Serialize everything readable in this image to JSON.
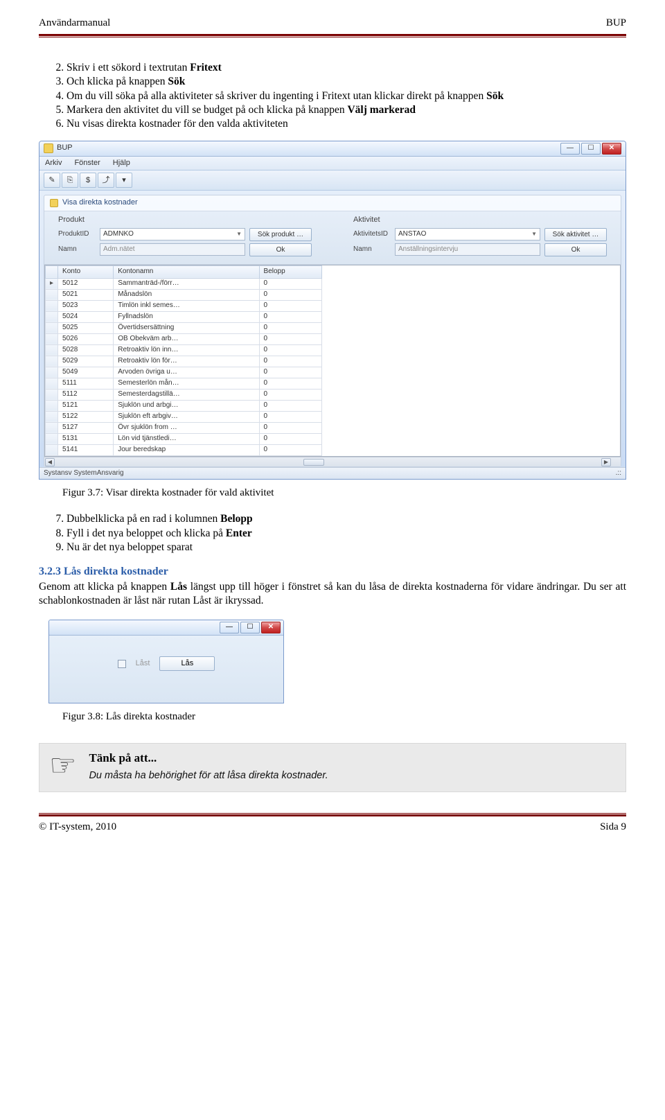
{
  "header": {
    "left": "Användarmanual",
    "right": "BUP"
  },
  "steps1": [
    {
      "pre": "Skriv i ett sökord i textrutan ",
      "b": "Fritext",
      "post": ""
    },
    {
      "pre": "Och klicka på knappen ",
      "b": "Sök",
      "post": ""
    },
    {
      "pre": "Om du vill söka på alla aktiviteter så skriver du ingenting i Fritext utan klickar direkt på knappen ",
      "b": "Sök",
      "post": ""
    },
    {
      "pre": "Markera den aktivitet du vill se budget på och klicka på knappen ",
      "b": "Välj markerad",
      "post": ""
    },
    {
      "pre": "Nu visas direkta kostnader för den valda aktiviteten",
      "b": "",
      "post": ""
    }
  ],
  "app": {
    "title": "BUP",
    "menu": [
      "Arkiv",
      "Fönster",
      "Hjälp"
    ],
    "tools": [
      "✎",
      "⎘",
      "$",
      "⤴",
      "▾"
    ],
    "panel_title": "Visa direkta kostnader",
    "filters": {
      "left": {
        "title": "Produkt",
        "row1": {
          "lbl": "ProduktID",
          "val": "ADMNKO",
          "btn": "Sök produkt …"
        },
        "row2": {
          "lbl": "Namn",
          "val": "Adm.nätet",
          "btn": "Ok"
        }
      },
      "right": {
        "title": "Aktivitet",
        "row1": {
          "lbl": "AktivitetsID",
          "val": "ANSTAO",
          "btn": "Sök aktivitet …"
        },
        "row2": {
          "lbl": "Namn",
          "val": "Anställningsintervju",
          "btn": "Ok"
        }
      }
    },
    "grid": {
      "cols": [
        "Konto",
        "Kontonamn",
        "Belopp"
      ],
      "rows": [
        [
          "5012",
          "Sammanträd-/förr…",
          "0"
        ],
        [
          "5021",
          "Månadslön",
          "0"
        ],
        [
          "5023",
          "Timlön inkl semes…",
          "0"
        ],
        [
          "5024",
          "Fyllnadslön",
          "0"
        ],
        [
          "5025",
          "Övertidsersättning",
          "0"
        ],
        [
          "5026",
          "OB Obekväm arb…",
          "0"
        ],
        [
          "5028",
          "Retroaktiv lön inn…",
          "0"
        ],
        [
          "5029",
          "Retroaktiv lön för…",
          "0"
        ],
        [
          "5049",
          "Arvoden övriga u…",
          "0"
        ],
        [
          "5111",
          "Semesterlön mån…",
          "0"
        ],
        [
          "5112",
          "Semesterdagstillä…",
          "0"
        ],
        [
          "5121",
          "Sjuklön und arbgi…",
          "0"
        ],
        [
          "5122",
          "Sjuklön eft arbgiv…",
          "0"
        ],
        [
          "5127",
          "Övr sjuklön from …",
          "0"
        ],
        [
          "5131",
          "Lön vid tjänstledi…",
          "0"
        ],
        [
          "5141",
          "Jour beredskap",
          "0"
        ]
      ]
    },
    "status": "Systansv SystemAnsvarig"
  },
  "fig37": "Figur 3.7: Visar direkta kostnader för vald aktivitet",
  "steps2": [
    {
      "pre": "Dubbelklicka på en rad i kolumnen ",
      "b": "Belopp",
      "post": ""
    },
    {
      "pre": "Fyll i det nya beloppet och klicka på ",
      "b": "Enter",
      "post": ""
    },
    {
      "pre": "Nu är det nya beloppet sparat",
      "b": "",
      "post": ""
    }
  ],
  "section323": {
    "title": "3.2.3 Lås direkta kostnader",
    "body_a": "Genom att klicka på knappen ",
    "body_b": "Lås",
    "body_c": " längst upp till höger i fönstret så kan du låsa de direkta kostnaderna för vidare ändringar. Du ser att schablonkostnaden är låst när rutan Låst är ikryssad."
  },
  "small": {
    "chk_label": "Låst",
    "btn": "Lås"
  },
  "fig38": "Figur 3.8: Lås direkta kostnader",
  "tip": {
    "title": "Tänk på att...",
    "body": "Du måsta ha behörighet för att låsa direkta kostnader."
  },
  "footer": {
    "left": "© IT-system, 2010",
    "right": "Sida 9"
  }
}
